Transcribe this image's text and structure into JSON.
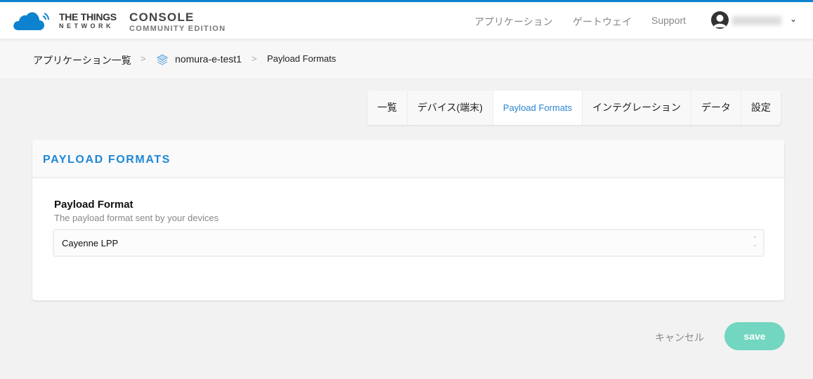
{
  "header": {
    "brand_line1": "THE THINGS",
    "brand_line2": "NETWORK",
    "console_title": "CONSOLE",
    "console_subtitle": "COMMUNITY EDITION",
    "nav": [
      {
        "label": "アプリケーション"
      },
      {
        "label": "ゲートウェイ"
      },
      {
        "label": "Support"
      }
    ],
    "user_icon": "user-avatar-icon",
    "user_menu_icon": "chevron-down-icon"
  },
  "breadcrumb": [
    {
      "label": "アプリケーション一覧"
    },
    {
      "label": "nomura-e-test1",
      "icon": "stack-layers-icon"
    },
    {
      "label": "Payload Formats"
    }
  ],
  "tabs": [
    {
      "label": "一覧"
    },
    {
      "label": "デバイス(端末)"
    },
    {
      "label": "Payload Formats",
      "active": true
    },
    {
      "label": "インテグレーション"
    },
    {
      "label": "データ"
    },
    {
      "label": "設定"
    }
  ],
  "card": {
    "title": "PAYLOAD FORMATS",
    "field_label": "Payload Format",
    "field_description": "The payload format sent by your devices",
    "select_value": "Cayenne LPP"
  },
  "actions": {
    "cancel_label": "キャンセル",
    "save_label": "save"
  },
  "colors": {
    "accent": "#0d83d0",
    "save": "#72d6c0",
    "active_tab": "#2b86d4"
  }
}
